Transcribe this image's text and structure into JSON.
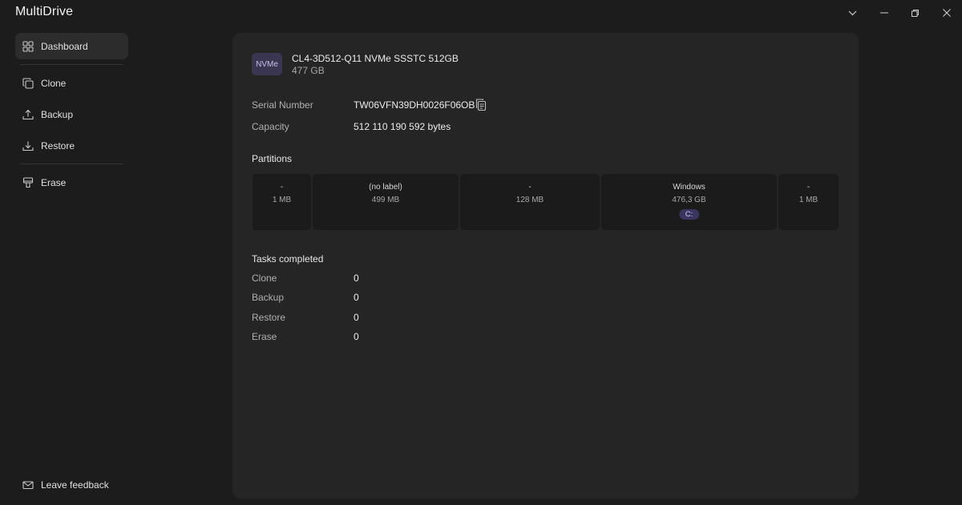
{
  "app": {
    "title": "MultiDrive"
  },
  "window_controls": [
    "chevron-down-icon",
    "minimize-icon",
    "restore-icon",
    "close-icon"
  ],
  "sidebar": {
    "items": [
      {
        "label": "Dashboard",
        "icon": "grid-icon",
        "active": true
      },
      {
        "label": "Clone",
        "icon": "clone-icon"
      },
      {
        "label": "Backup",
        "icon": "upload-icon"
      },
      {
        "label": "Restore",
        "icon": "download-icon"
      },
      {
        "label": "Erase",
        "icon": "eraser-icon"
      }
    ],
    "feedback": {
      "label": "Leave feedback",
      "icon": "mail-icon"
    }
  },
  "drive": {
    "type_badge": "NVMe",
    "name": "CL4-3D512-Q11 NVMe SSSTC 512GB",
    "size": "477 GB",
    "serial_label": "Serial Number",
    "serial_value": "TW06VFN39DH0026F06OB",
    "capacity_label": "Capacity",
    "capacity_value": "512 110 190 592 bytes"
  },
  "partitions": {
    "title": "Partitions",
    "items": [
      {
        "name": "-",
        "size": "1 MB",
        "letter": ""
      },
      {
        "name": "(no label)",
        "size": "499 MB",
        "letter": ""
      },
      {
        "name": "-",
        "size": "128 MB",
        "letter": ""
      },
      {
        "name": "Windows",
        "size": "476,3 GB",
        "letter": "C:"
      },
      {
        "name": "-",
        "size": "1 MB",
        "letter": ""
      }
    ]
  },
  "tasks": {
    "title": "Tasks completed",
    "items": [
      {
        "label": "Clone",
        "value": "0"
      },
      {
        "label": "Backup",
        "value": "0"
      },
      {
        "label": "Restore",
        "value": "0"
      },
      {
        "label": "Erase",
        "value": "0"
      }
    ]
  },
  "colors": {
    "background": "#1c1c1c",
    "panel": "#252525",
    "accent": "#3a3550"
  }
}
